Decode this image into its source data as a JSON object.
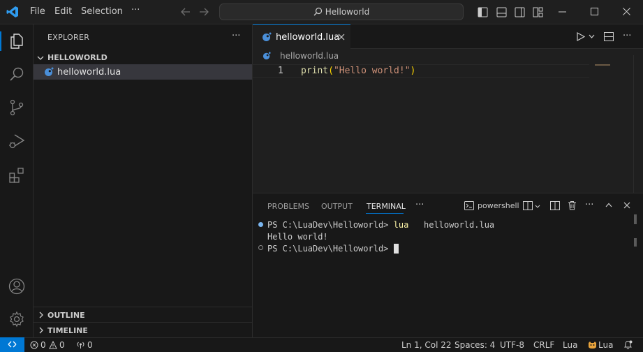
{
  "titlebar": {
    "menu": [
      "File",
      "Edit",
      "Selection"
    ],
    "more": "···",
    "search_text": "Helloworld"
  },
  "sidebar": {
    "title": "EXPLORER",
    "more": "···",
    "folder": "HELLOWORLD",
    "file": "helloworld.lua",
    "outline": "OUTLINE",
    "timeline": "TIMELINE"
  },
  "editor": {
    "tab_label": "helloworld.lua",
    "breadcrumb": "helloworld.lua",
    "line_number": "1",
    "code_fn": "print",
    "code_open": "(",
    "code_string": "\"Hello world!\"",
    "code_close": ")"
  },
  "panel": {
    "tabs": [
      "PROBLEMS",
      "OUTPUT",
      "TERMINAL"
    ],
    "more": "···",
    "shell_label": "powershell",
    "terminal": {
      "prompt1": "PS C:\\LuaDev\\Helloworld>",
      "cmd": "lua",
      "arg": "helloworld.lua",
      "output": "Hello world!",
      "prompt2": "PS C:\\LuaDev\\Helloworld>"
    }
  },
  "statusbar": {
    "errors": "0",
    "warnings": "0",
    "ports": "0",
    "position": "Ln 1, Col 22",
    "spaces": "Spaces: 4",
    "encoding": "UTF-8",
    "eol": "CRLF",
    "language": "Lua",
    "lua_ext": "Lua"
  },
  "colors": {
    "accent": "#0078d4",
    "lua_icon": "#4a8fd9",
    "keyword_fn": "#dcdcaa",
    "string": "#ce9178",
    "bracket": "#ffd700",
    "cmd_yellow": "#f9f1a5"
  }
}
